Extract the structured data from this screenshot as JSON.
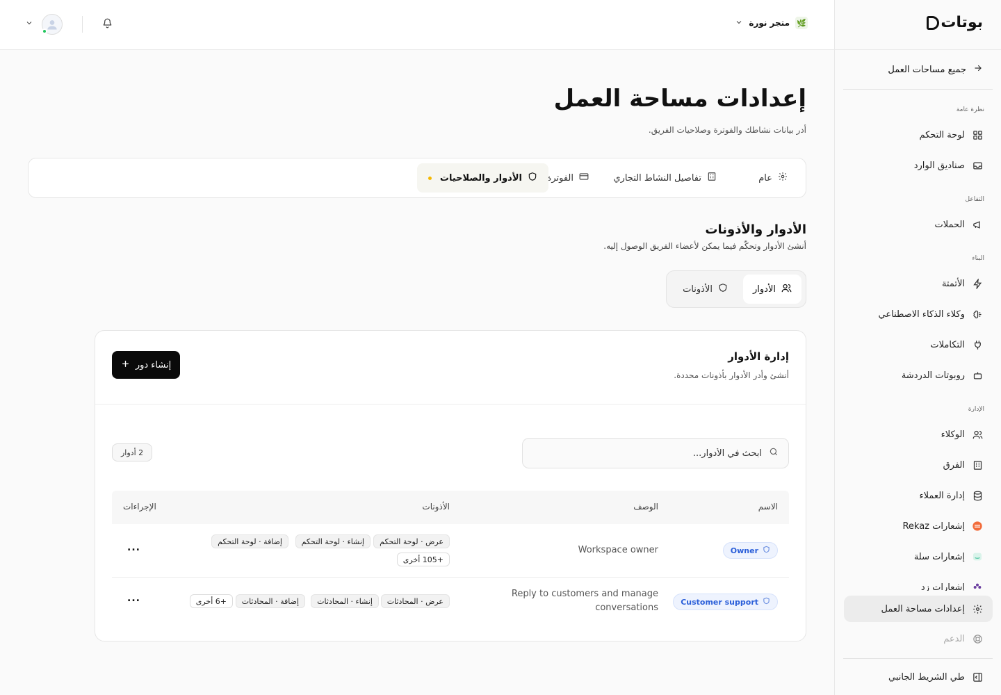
{
  "sidebar": {
    "logo": "بوتات",
    "back_link": "جميع مساحات العمل",
    "sections": {
      "overview": "نظرة عامة",
      "engagement": "التفاعل",
      "build": "البناء",
      "admin": "الإدارة"
    },
    "items": {
      "dashboard": "لوحة التحكم",
      "inboxes": "صناديق الوارد",
      "campaigns": "الحملات",
      "automation": "الأتمتة",
      "ai_agents": "وكلاء الذكاء الاصطناعي",
      "integrations": "التكاملات",
      "chatbots": "روبوتات الدردشة",
      "agents": "الوكلاء",
      "teams": "الفرق",
      "customers": "إدارة العملاء",
      "rekaz": "إشعارات Rekaz",
      "salla": "إشعارات سلة",
      "zid": "إشعارات زد",
      "workspace_settings": "إعدادات مساحة العمل",
      "support": "الدعم",
      "collapse": "طي الشريط الجانبي"
    }
  },
  "topbar": {
    "store_name": "متجر نورة"
  },
  "page": {
    "title": "إعدادات مساحة العمل",
    "subtitle": "أدر بيانات نشاطك والفوترة وصلاحيات الفريق."
  },
  "tabs": {
    "general": "عام",
    "business": "تفاصيل النشاط التجاري",
    "billing": "الفوترة",
    "roles": "الأدوار والصلاحيات"
  },
  "section": {
    "title": "الأدوار والأذونات",
    "subtitle": "أنشئ الأدوار وتحكّم فيما يمكن لأعضاء الفريق الوصول إليه."
  },
  "subtabs": {
    "roles": "الأدوار",
    "permissions": "الأذونات"
  },
  "card": {
    "title": "إدارة الأدوار",
    "subtitle": "أنشئ وأدر الأدوار بأذونات محددة.",
    "create_button": "إنشاء دور",
    "search_placeholder": "ابحث في الأدوار...",
    "count": "2 أدوار"
  },
  "table": {
    "headers": {
      "name": "الاسم",
      "description": "الوصف",
      "permissions": "الأذونات",
      "actions": "الإجراءات"
    },
    "rows": [
      {
        "name": "Owner",
        "description": "Workspace owner",
        "chips": [
          "عرض · لوحة التحكم",
          "إنشاء · لوحة التحكم",
          "إضافة · لوحة التحكم"
        ],
        "more": "+105 أخرى",
        "actions": "..."
      },
      {
        "name": "Customer support",
        "description_line1": "Reply to customers and manage",
        "description_line2": "conversations",
        "chips": [
          "عرض · المحادثات",
          "إنشاء · المحادثات",
          "إضافة · المحادثات"
        ],
        "more": "+6 أخرى",
        "actions": "..."
      }
    ]
  }
}
